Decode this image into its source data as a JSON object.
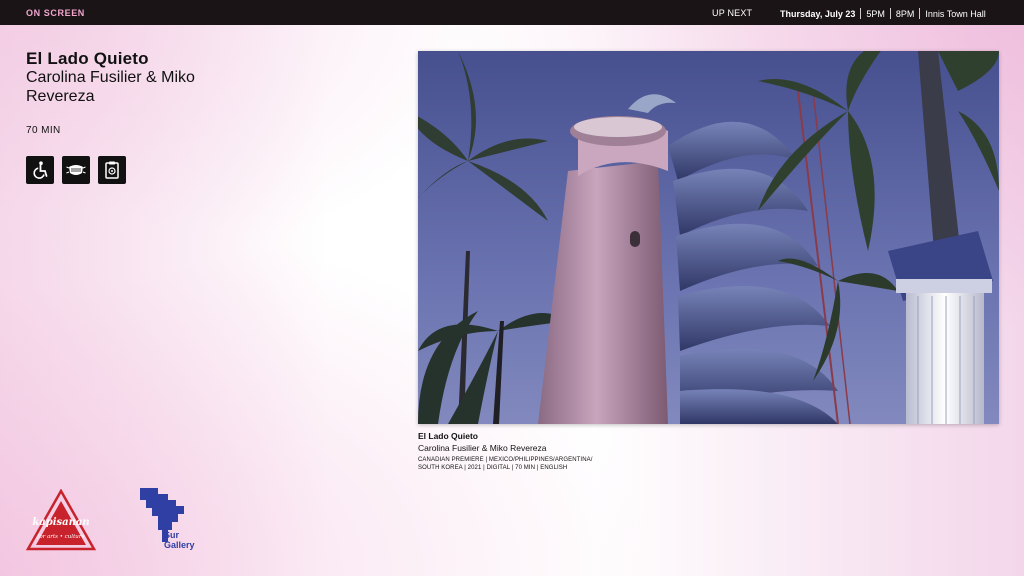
{
  "topbar": {
    "section_label": "ON SCREEN",
    "up_next_label": "UP NEXT",
    "date": "Thursday, July 23",
    "times": [
      "5PM",
      "8PM"
    ],
    "venue": "Innis Town Hall",
    "accent_color": "#f2a7cf"
  },
  "film": {
    "title": "El Lado Quieto",
    "directors": "Carolina Fusilier & Miko Revereza",
    "runtime": "70 MIN",
    "accessibility_icons": [
      "wheelchair-icon",
      "face-mask-icon",
      "clipboard-icon"
    ]
  },
  "caption": {
    "title": "El Lado Quieto",
    "directors": "Carolina Fusilier & Miko Revereza",
    "details": "CANADIAN PREMIERE | MEXICO/PHILIPPINES/ARGENTINA/ SOUTH KOREA | 2021 | DIGITAL | 70 MIN | ENGLISH"
  },
  "sponsors": {
    "kapisanan": {
      "name": "kapisanan",
      "tagline": "for arts • culture"
    },
    "sur": {
      "line1": "Sur",
      "line2": "Gallery"
    }
  }
}
